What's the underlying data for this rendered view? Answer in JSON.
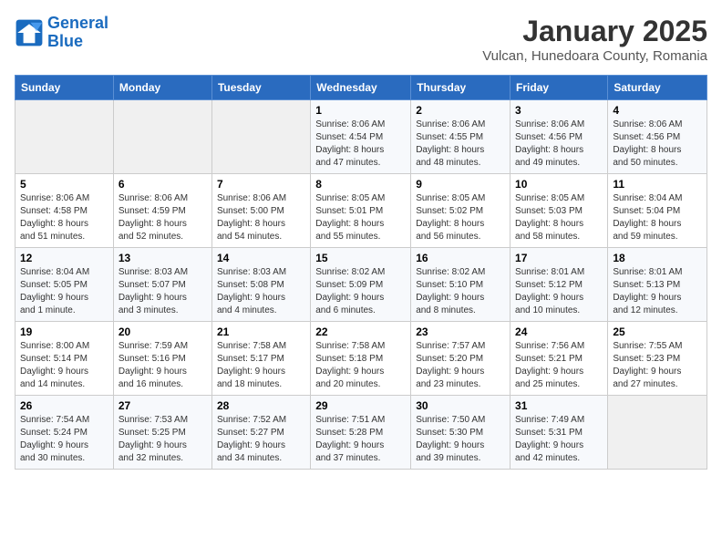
{
  "logo": {
    "line1": "General",
    "line2": "Blue"
  },
  "title": "January 2025",
  "subtitle": "Vulcan, Hunedoara County, Romania",
  "headers": [
    "Sunday",
    "Monday",
    "Tuesday",
    "Wednesday",
    "Thursday",
    "Friday",
    "Saturday"
  ],
  "weeks": [
    [
      {
        "day": "",
        "info": ""
      },
      {
        "day": "",
        "info": ""
      },
      {
        "day": "",
        "info": ""
      },
      {
        "day": "1",
        "info": "Sunrise: 8:06 AM\nSunset: 4:54 PM\nDaylight: 8 hours\nand 47 minutes."
      },
      {
        "day": "2",
        "info": "Sunrise: 8:06 AM\nSunset: 4:55 PM\nDaylight: 8 hours\nand 48 minutes."
      },
      {
        "day": "3",
        "info": "Sunrise: 8:06 AM\nSunset: 4:56 PM\nDaylight: 8 hours\nand 49 minutes."
      },
      {
        "day": "4",
        "info": "Sunrise: 8:06 AM\nSunset: 4:56 PM\nDaylight: 8 hours\nand 50 minutes."
      }
    ],
    [
      {
        "day": "5",
        "info": "Sunrise: 8:06 AM\nSunset: 4:58 PM\nDaylight: 8 hours\nand 51 minutes."
      },
      {
        "day": "6",
        "info": "Sunrise: 8:06 AM\nSunset: 4:59 PM\nDaylight: 8 hours\nand 52 minutes."
      },
      {
        "day": "7",
        "info": "Sunrise: 8:06 AM\nSunset: 5:00 PM\nDaylight: 8 hours\nand 54 minutes."
      },
      {
        "day": "8",
        "info": "Sunrise: 8:05 AM\nSunset: 5:01 PM\nDaylight: 8 hours\nand 55 minutes."
      },
      {
        "day": "9",
        "info": "Sunrise: 8:05 AM\nSunset: 5:02 PM\nDaylight: 8 hours\nand 56 minutes."
      },
      {
        "day": "10",
        "info": "Sunrise: 8:05 AM\nSunset: 5:03 PM\nDaylight: 8 hours\nand 58 minutes."
      },
      {
        "day": "11",
        "info": "Sunrise: 8:04 AM\nSunset: 5:04 PM\nDaylight: 8 hours\nand 59 minutes."
      }
    ],
    [
      {
        "day": "12",
        "info": "Sunrise: 8:04 AM\nSunset: 5:05 PM\nDaylight: 9 hours\nand 1 minute."
      },
      {
        "day": "13",
        "info": "Sunrise: 8:03 AM\nSunset: 5:07 PM\nDaylight: 9 hours\nand 3 minutes."
      },
      {
        "day": "14",
        "info": "Sunrise: 8:03 AM\nSunset: 5:08 PM\nDaylight: 9 hours\nand 4 minutes."
      },
      {
        "day": "15",
        "info": "Sunrise: 8:02 AM\nSunset: 5:09 PM\nDaylight: 9 hours\nand 6 minutes."
      },
      {
        "day": "16",
        "info": "Sunrise: 8:02 AM\nSunset: 5:10 PM\nDaylight: 9 hours\nand 8 minutes."
      },
      {
        "day": "17",
        "info": "Sunrise: 8:01 AM\nSunset: 5:12 PM\nDaylight: 9 hours\nand 10 minutes."
      },
      {
        "day": "18",
        "info": "Sunrise: 8:01 AM\nSunset: 5:13 PM\nDaylight: 9 hours\nand 12 minutes."
      }
    ],
    [
      {
        "day": "19",
        "info": "Sunrise: 8:00 AM\nSunset: 5:14 PM\nDaylight: 9 hours\nand 14 minutes."
      },
      {
        "day": "20",
        "info": "Sunrise: 7:59 AM\nSunset: 5:16 PM\nDaylight: 9 hours\nand 16 minutes."
      },
      {
        "day": "21",
        "info": "Sunrise: 7:58 AM\nSunset: 5:17 PM\nDaylight: 9 hours\nand 18 minutes."
      },
      {
        "day": "22",
        "info": "Sunrise: 7:58 AM\nSunset: 5:18 PM\nDaylight: 9 hours\nand 20 minutes."
      },
      {
        "day": "23",
        "info": "Sunrise: 7:57 AM\nSunset: 5:20 PM\nDaylight: 9 hours\nand 23 minutes."
      },
      {
        "day": "24",
        "info": "Sunrise: 7:56 AM\nSunset: 5:21 PM\nDaylight: 9 hours\nand 25 minutes."
      },
      {
        "day": "25",
        "info": "Sunrise: 7:55 AM\nSunset: 5:23 PM\nDaylight: 9 hours\nand 27 minutes."
      }
    ],
    [
      {
        "day": "26",
        "info": "Sunrise: 7:54 AM\nSunset: 5:24 PM\nDaylight: 9 hours\nand 30 minutes."
      },
      {
        "day": "27",
        "info": "Sunrise: 7:53 AM\nSunset: 5:25 PM\nDaylight: 9 hours\nand 32 minutes."
      },
      {
        "day": "28",
        "info": "Sunrise: 7:52 AM\nSunset: 5:27 PM\nDaylight: 9 hours\nand 34 minutes."
      },
      {
        "day": "29",
        "info": "Sunrise: 7:51 AM\nSunset: 5:28 PM\nDaylight: 9 hours\nand 37 minutes."
      },
      {
        "day": "30",
        "info": "Sunrise: 7:50 AM\nSunset: 5:30 PM\nDaylight: 9 hours\nand 39 minutes."
      },
      {
        "day": "31",
        "info": "Sunrise: 7:49 AM\nSunset: 5:31 PM\nDaylight: 9 hours\nand 42 minutes."
      },
      {
        "day": "",
        "info": ""
      }
    ]
  ]
}
